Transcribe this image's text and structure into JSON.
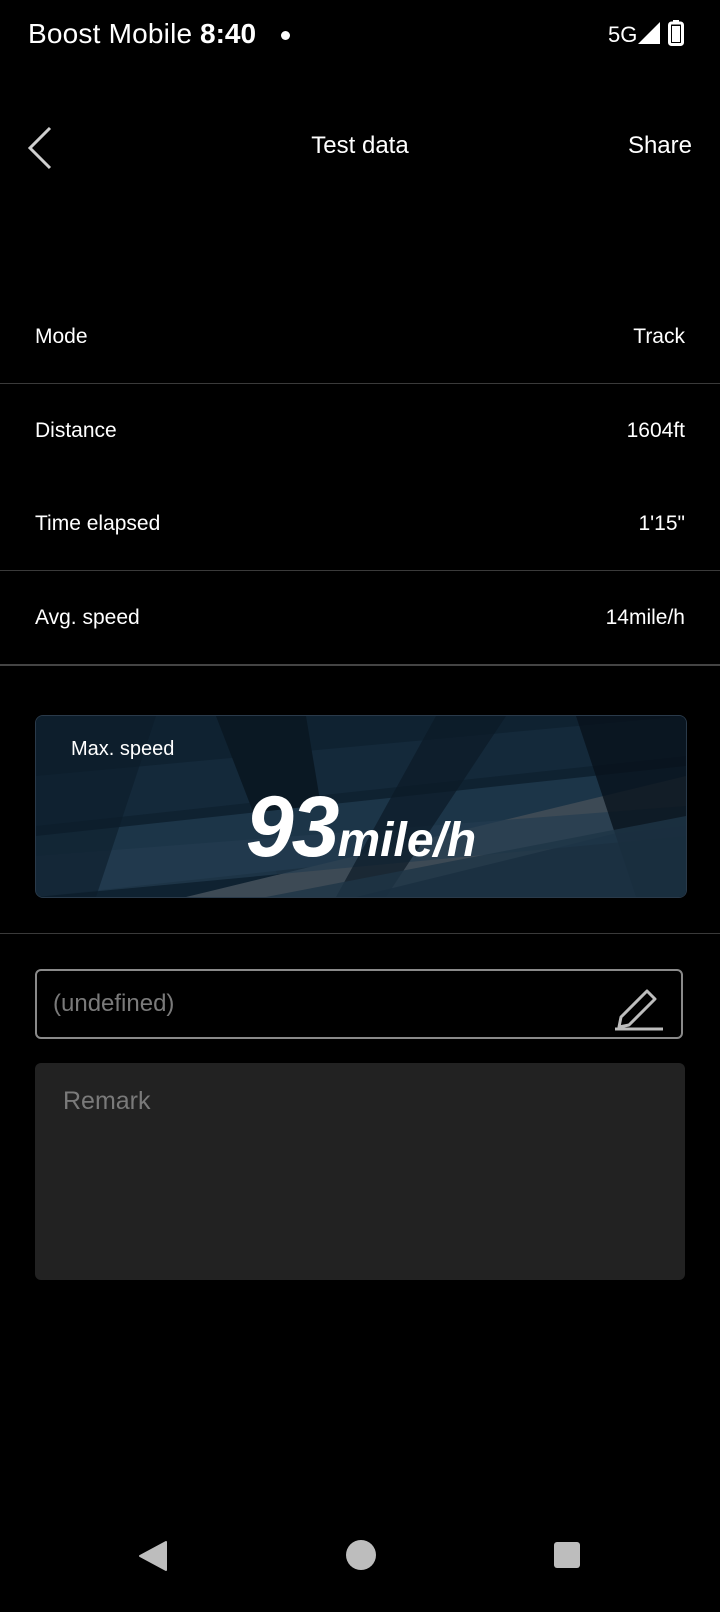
{
  "status_bar": {
    "carrier": "Boost Mobile",
    "time": "8:40",
    "network": "5G",
    "icons": [
      "notification-dot-icon",
      "signal-icon",
      "battery-icon"
    ]
  },
  "header": {
    "title": "Test data",
    "share_label": "Share",
    "back_icon": "chevron-left-icon"
  },
  "stats": [
    {
      "label": "Mode",
      "value": "Track"
    },
    {
      "label": "Distance",
      "value": "1604ft"
    },
    {
      "label": "Time elapsed",
      "value": "1'15\""
    },
    {
      "label": "Avg. speed",
      "value": "14mile/h"
    }
  ],
  "max_speed": {
    "label": "Max. speed",
    "value": "93",
    "unit": "mile/h"
  },
  "name_field": {
    "placeholder": "(undefined)",
    "edit_icon": "pencil-icon"
  },
  "remark": {
    "placeholder": "Remark"
  },
  "nav_bar": {
    "icons": [
      "nav-back-icon",
      "nav-home-icon",
      "nav-recents-icon"
    ]
  },
  "colors": {
    "background": "#000000",
    "text": "#ffffff",
    "placeholder": "#7a7a7a",
    "card_base": "#0e1e2b",
    "remark_bg": "#222222"
  }
}
